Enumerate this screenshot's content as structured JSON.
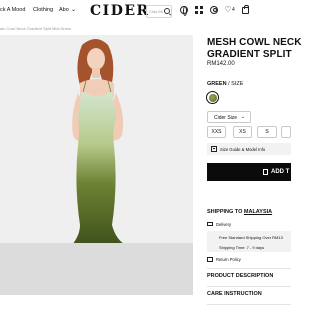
{
  "header": {
    "nav": [
      "ck A Mood",
      "Clothing",
      "Abo"
    ],
    "logo": "CIDER",
    "search_placeholder": "Cido Mi",
    "wishlist_count": "4"
  },
  "breadcrumb": "ain Cowl Neck Gradient Split Midi Dress",
  "product": {
    "title_line1": "MESH COWL NECK",
    "title_line2": "GRADIENT SPLIT",
    "price": "RM142.00",
    "color_label": "GREEN",
    "size_suffix": " / SIZE",
    "size_type": "Cider Size",
    "sizes": [
      "XXS",
      "XS",
      "S",
      ""
    ],
    "size_guide": "Size Guide & Model Info",
    "add_to_bag": "ADD T"
  },
  "shipping": {
    "title_prefix": "SHIPPING TO ",
    "country": "MALAYSIA",
    "delivery": "Delivery",
    "free_shipping": "Free Standard Shipping Over RM13",
    "shipping_time": "Shipping Time: 7 - 9 days",
    "return_policy": "Return Policy"
  },
  "sections": [
    "PRODUCT DESCRIPTION",
    "CARE INSTRUCTION"
  ],
  "colors": {
    "accent": "#0b0b0b",
    "swatch": "#6f7a33",
    "dress_top": "#cfe3cf",
    "dress_bottom": "#3f521d",
    "hair": "#a0522d"
  }
}
